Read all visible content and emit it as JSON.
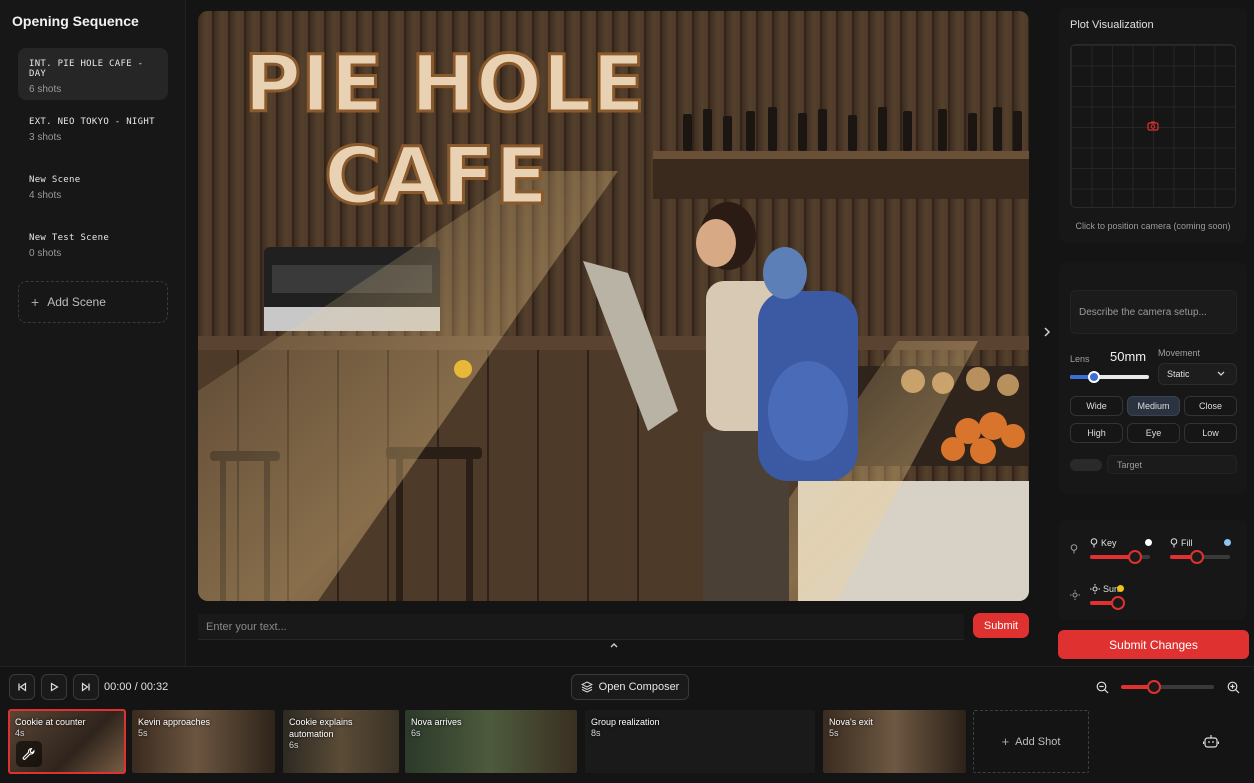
{
  "project": {
    "title": "Opening Sequence"
  },
  "scenes": [
    {
      "name": "INT. PIE HOLE CAFE - DAY",
      "shots": "6 shots",
      "active": true
    },
    {
      "name": "EXT. NEO TOKYO - NIGHT",
      "shots": "3 shots"
    },
    {
      "name": "New Scene",
      "shots": "4 shots"
    },
    {
      "name": "New Test Scene",
      "shots": "0 shots"
    }
  ],
  "add_scene_label": "Add Scene",
  "viewer": {
    "signage_line1": "PIE HOLE",
    "signage_line2": "CAFE"
  },
  "prompt": {
    "placeholder": "Enter your text...",
    "submit_label": "Submit"
  },
  "plot": {
    "title": "Plot Visualization",
    "hint": "Click to position camera (coming soon)"
  },
  "camera": {
    "description_placeholder": "Describe the camera setup...",
    "lens_label": "Lens",
    "lens_value": "50mm",
    "lens_level": 0.3,
    "movement_label": "Movement",
    "movement_value": "Static",
    "framing": [
      "Wide",
      "Medium",
      "Close"
    ],
    "framing_selected": "Medium",
    "angles": [
      "High",
      "Eye",
      "Low"
    ],
    "target_label": "Target"
  },
  "lighting": {
    "key_label": "Key",
    "key_level": 0.75,
    "key_color": "#ffffff",
    "fill_label": "Fill",
    "fill_level": 0.45,
    "fill_color": "#8ec5f0",
    "sun_label": "Sun",
    "sun_level": 0.85,
    "sun_color": "#f2c21b"
  },
  "submit_changes_label": "Submit Changes",
  "timeline": {
    "time": "00:00 / 00:32",
    "composer_label": "Open Composer",
    "zoom_level": 0.36,
    "add_shot_label": "Add Shot",
    "shots": [
      {
        "title": "Cookie at counter",
        "duration": "4s",
        "active": true
      },
      {
        "title": "Kevin approaches",
        "duration": "5s"
      },
      {
        "title": "Cookie explains automation",
        "duration": "6s"
      },
      {
        "title": "Nova arrives",
        "duration": "6s"
      },
      {
        "title": "Group realization",
        "duration": "8s"
      },
      {
        "title": "Nova's exit",
        "duration": "5s"
      }
    ]
  },
  "colors": {
    "accent": "#e03131",
    "selected_chip": "#2b3340",
    "lens_slider": "#3b6fd4"
  }
}
